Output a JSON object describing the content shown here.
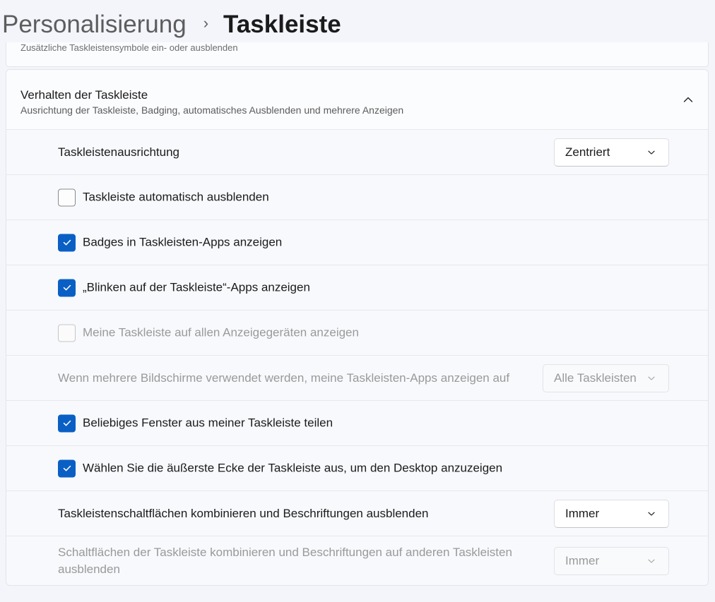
{
  "breadcrumb": {
    "parent": "Personalisierung",
    "separator": "›",
    "current": "Taskleiste"
  },
  "prev_card": {
    "text": "Zusätzliche Taskleistensymbole ein- oder ausblenden"
  },
  "section": {
    "title": "Verhalten der Taskleiste",
    "subtitle": "Ausrichtung der Taskleiste, Badging, automatisches Ausblenden und mehrere Anzeigen",
    "expanded": true
  },
  "settings": {
    "alignment": {
      "label": "Taskleistenausrichtung",
      "value": "Zentriert"
    },
    "autohide": {
      "label": "Taskleiste automatisch ausblenden",
      "checked": false
    },
    "badges": {
      "label": "Badges in Taskleisten-Apps anzeigen",
      "checked": true
    },
    "flashing": {
      "label": "„Blinken auf der Taskleiste“-Apps anzeigen",
      "checked": true
    },
    "all_displays": {
      "label": "Meine Taskleiste auf allen Anzeigegeräten anzeigen",
      "checked": false,
      "disabled": true
    },
    "multi_monitor": {
      "label": "Wenn mehrere Bildschirme verwendet werden, meine Taskleisten-Apps anzeigen auf",
      "value": "Alle Taskleisten",
      "disabled": true
    },
    "share_window": {
      "label": "Beliebiges Fenster aus meiner Taskleiste teilen",
      "checked": true
    },
    "corner_desktop": {
      "label": "Wählen Sie die äußerste Ecke der Taskleiste aus, um den Desktop anzuzeigen",
      "checked": true
    },
    "combine": {
      "label": "Taskleistenschaltflächen kombinieren und Beschriftungen ausblenden",
      "value": "Immer"
    },
    "combine_other": {
      "label": "Schaltflächen der Taskleiste kombinieren und Beschriftungen auf anderen Taskleisten ausblenden",
      "value": "Immer",
      "disabled": true
    }
  },
  "colors": {
    "accent": "#0a5fc4",
    "background": "#f3f5fb",
    "card": "#fbfcfe",
    "disabled_text": "#9a9a9a"
  },
  "icons": {
    "collapse": "chevron-up-icon",
    "dropdown": "chevron-down-icon",
    "check": "checkmark-icon",
    "separator": "chevron-right-icon"
  }
}
